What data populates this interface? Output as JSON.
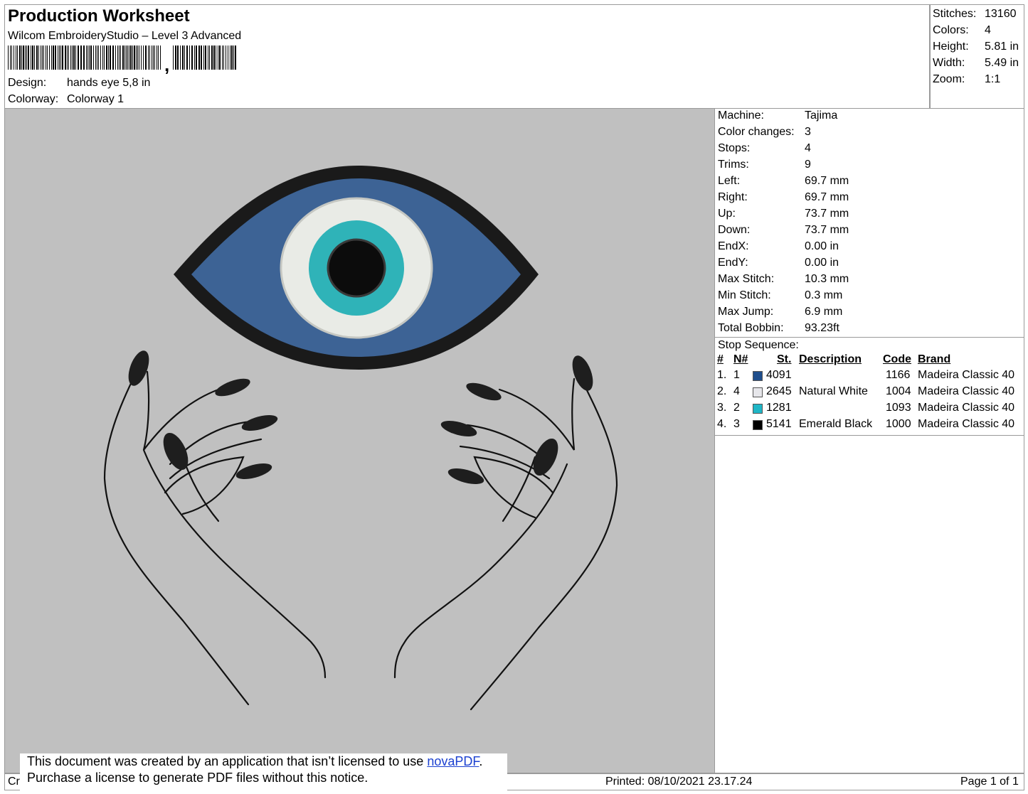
{
  "header": {
    "title": "Production Worksheet",
    "software": "Wilcom EmbroideryStudio – Level 3 Advanced",
    "barcode_comma": ",",
    "design_label": "Design:",
    "design_value": "hands eye 5,8 in",
    "colorway_label": "Colorway:",
    "colorway_value": "Colorway 1"
  },
  "summary": [
    {
      "label": "Stitches:",
      "value": "13160"
    },
    {
      "label": "Colors:",
      "value": "4"
    },
    {
      "label": "Height:",
      "value": "5.81 in"
    },
    {
      "label": "Width:",
      "value": "5.49 in"
    },
    {
      "label": "Zoom:",
      "value": "1:1"
    }
  ],
  "specs": [
    {
      "label": "Machine:",
      "value": "Tajima"
    },
    {
      "label": "Color changes:",
      "value": "3"
    },
    {
      "label": "Stops:",
      "value": "4"
    },
    {
      "label": "Trims:",
      "value": "9"
    },
    {
      "label": "Left:",
      "value": "69.7 mm"
    },
    {
      "label": "Right:",
      "value": "69.7 mm"
    },
    {
      "label": "Up:",
      "value": "73.7 mm"
    },
    {
      "label": "Down:",
      "value": "73.7 mm"
    },
    {
      "label": "EndX:",
      "value": "0.00 in"
    },
    {
      "label": "EndY:",
      "value": "0.00 in"
    },
    {
      "label": "Max Stitch:",
      "value": "10.3 mm"
    },
    {
      "label": "Min Stitch:",
      "value": "0.3 mm"
    },
    {
      "label": "Max Jump:",
      "value": "6.9 mm"
    },
    {
      "label": "Total Bobbin:",
      "value": "93.23ft"
    }
  ],
  "stop_sequence": {
    "title": "Stop Sequence:",
    "headers": {
      "num": "#",
      "n": "N#",
      "st": "St.",
      "desc": "Description",
      "code": "Code",
      "brand": "Brand"
    },
    "rows": [
      {
        "num": "1.",
        "n": "1",
        "color": "#1f4e8c",
        "st": "4091",
        "desc": "",
        "code": "1166",
        "brand": "Madeira Classic 40"
      },
      {
        "num": "2.",
        "n": "4",
        "color": "#e6e6ea",
        "st": "2645",
        "desc": "Natural White",
        "code": "1004",
        "brand": "Madeira Classic 40"
      },
      {
        "num": "3.",
        "n": "2",
        "color": "#1fb6c6",
        "st": "1281",
        "desc": "",
        "code": "1093",
        "brand": "Madeira Classic 40"
      },
      {
        "num": "4.",
        "n": "3",
        "color": "#000000",
        "st": "5141",
        "desc": "Emerald Black",
        "code": "1000",
        "brand": "Madeira Classic 40"
      }
    ]
  },
  "footer": {
    "left_fragment": "Cr",
    "notice_line1_pre": "This document was created by an application that isn’t licensed to use ",
    "notice_link": "novaPDF",
    "notice_line1_post": ".",
    "notice_line2": "Purchase a license to generate PDF files without this notice.",
    "printed": "Printed: 08/10/2021 23.17.24",
    "page": "Page 1 of 1"
  },
  "colors": {
    "canvas_bg": "#c0c0c0",
    "eye_blue": "#3d6395",
    "eye_outline": "#1a1a1a",
    "iris_white": "#e9ebe6",
    "iris_teal": "#2fb3b8",
    "pupil": "#0c0c0c"
  }
}
